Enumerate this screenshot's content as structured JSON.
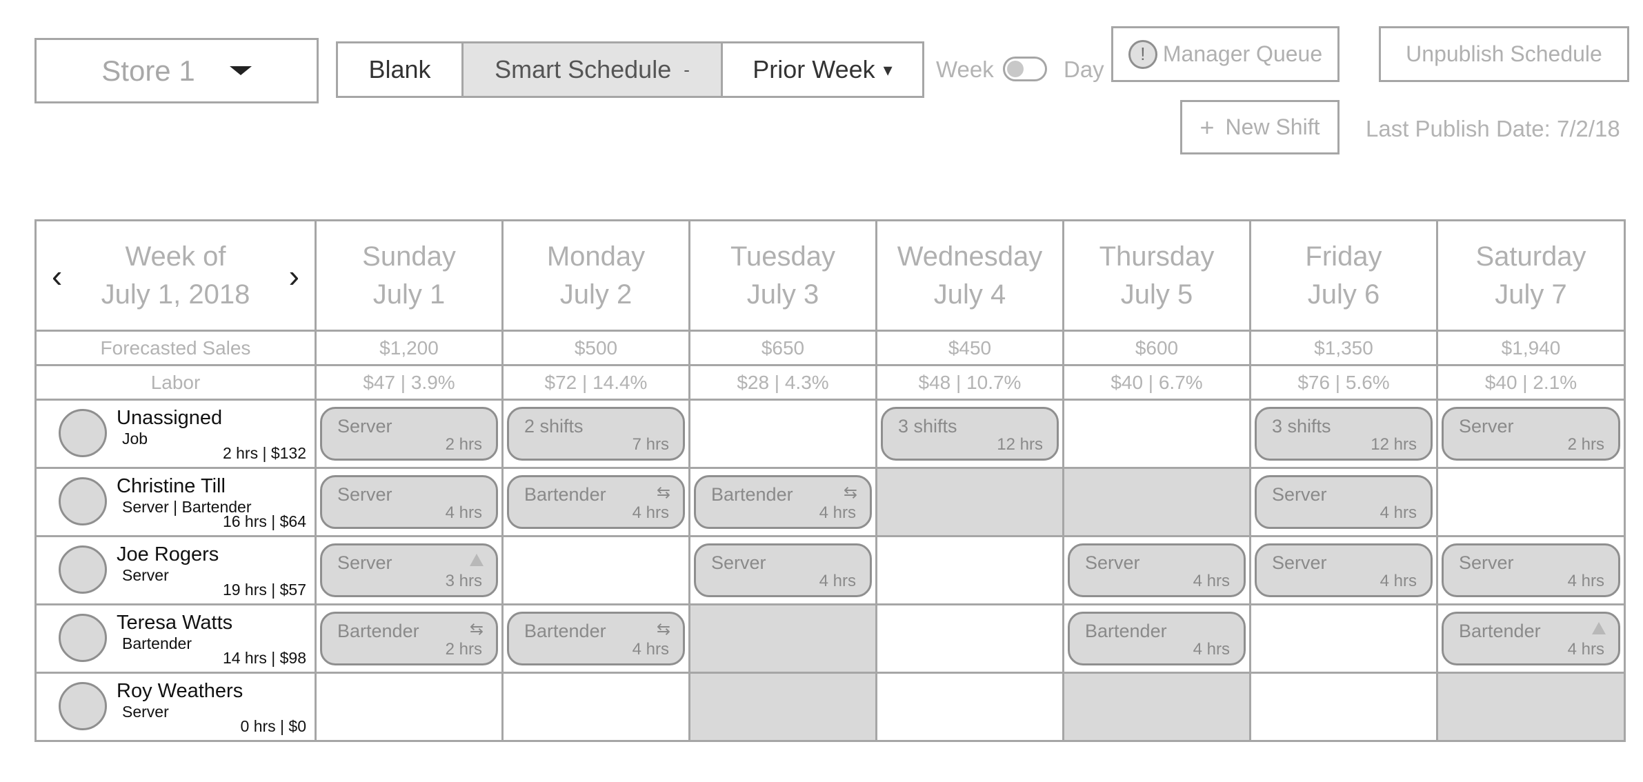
{
  "store_selector": {
    "value": "Store 1"
  },
  "schedule_modes": {
    "blank": "Blank",
    "smart": "Smart Schedule",
    "prior": "Prior Week",
    "dropdown_glyph": "-",
    "prior_dropdown_glyph": "▾"
  },
  "view_toggle": {
    "week": "Week",
    "day": "Day",
    "selected": "Week"
  },
  "manager_queue": {
    "icon_text": "!",
    "label": "Manager Queue"
  },
  "unpublish": {
    "label": "Unpublish Schedule"
  },
  "new_shift": {
    "plus": "+",
    "label": "New Shift"
  },
  "last_publish": "Last Publish Date: 7/2/18",
  "week": {
    "line1": "Week of",
    "line2": "July 1, 2018",
    "prev_glyph": "‹",
    "next_glyph": "›"
  },
  "days": [
    {
      "name": "Sunday",
      "date": "July 1"
    },
    {
      "name": "Monday",
      "date": "July 2"
    },
    {
      "name": "Tuesday",
      "date": "July 3"
    },
    {
      "name": "Wednesday",
      "date": "July 4"
    },
    {
      "name": "Thursday",
      "date": "July 5"
    },
    {
      "name": "Friday",
      "date": "July 6"
    },
    {
      "name": "Saturday",
      "date": "July 7"
    }
  ],
  "forecasted_sales": {
    "label": "Forecasted Sales",
    "values": [
      "$1,200",
      "$500",
      "$650",
      "$450",
      "$600",
      "$1,350",
      "$1,940"
    ]
  },
  "labor": {
    "label": "Labor",
    "values": [
      "$47 | 3.9%",
      "$72 | 14.4%",
      "$28 | 4.3%",
      "$48 | 10.7%",
      "$40 | 6.7%",
      "$76 | 5.6%",
      "$40 | 2.1%"
    ]
  },
  "swap_glyph": "⇆",
  "employees": [
    {
      "name": "Unassigned",
      "role": "Job",
      "summary": "2 hrs | $132",
      "cells": [
        {
          "shift": {
            "title": "Server",
            "hours": "2 hrs"
          }
        },
        {
          "shift": {
            "title": "2 shifts",
            "hours": "7 hrs"
          }
        },
        {},
        {
          "shift": {
            "title": "3 shifts",
            "hours": "12 hrs"
          }
        },
        {},
        {
          "shift": {
            "title": "3 shifts",
            "hours": "12 hrs"
          }
        },
        {
          "shift": {
            "title": "Server",
            "hours": "2 hrs"
          }
        }
      ]
    },
    {
      "name": "Christine Till",
      "role": "Server | Bartender",
      "summary": "16 hrs | $64",
      "cells": [
        {
          "shift": {
            "title": "Server",
            "hours": "4 hrs"
          }
        },
        {
          "shift": {
            "title": "Bartender",
            "hours": "4 hrs",
            "icon": "swap"
          }
        },
        {
          "shift": {
            "title": "Bartender",
            "hours": "4 hrs",
            "icon": "swap"
          }
        },
        {
          "unavailable": true
        },
        {
          "unavailable": true
        },
        {
          "shift": {
            "title": "Server",
            "hours": "4 hrs"
          }
        },
        {}
      ]
    },
    {
      "name": "Joe Rogers",
      "role": "Server",
      "summary": "19 hrs | $57",
      "cells": [
        {
          "shift": {
            "title": "Server",
            "hours": "3 hrs",
            "icon": "warning"
          }
        },
        {},
        {
          "shift": {
            "title": "Server",
            "hours": "4 hrs"
          }
        },
        {},
        {
          "shift": {
            "title": "Server",
            "hours": "4 hrs"
          }
        },
        {
          "shift": {
            "title": "Server",
            "hours": "4 hrs"
          }
        },
        {
          "shift": {
            "title": "Server",
            "hours": "4 hrs"
          }
        }
      ]
    },
    {
      "name": "Teresa Watts",
      "role": "Bartender",
      "summary": "14 hrs | $98",
      "cells": [
        {
          "shift": {
            "title": "Bartender",
            "hours": "2 hrs",
            "icon": "swap"
          }
        },
        {
          "shift": {
            "title": "Bartender",
            "hours": "4 hrs",
            "icon": "swap"
          }
        },
        {
          "unavailable": true
        },
        {},
        {
          "shift": {
            "title": "Bartender",
            "hours": "4 hrs"
          }
        },
        {},
        {
          "shift": {
            "title": "Bartender",
            "hours": "4 hrs",
            "icon": "warning"
          }
        }
      ]
    },
    {
      "name": "Roy Weathers",
      "role": "Server",
      "summary": "0 hrs | $0",
      "cells": [
        {},
        {},
        {
          "unavailable": true
        },
        {},
        {
          "unavailable": true
        },
        {},
        {
          "unavailable": true
        }
      ]
    }
  ]
}
